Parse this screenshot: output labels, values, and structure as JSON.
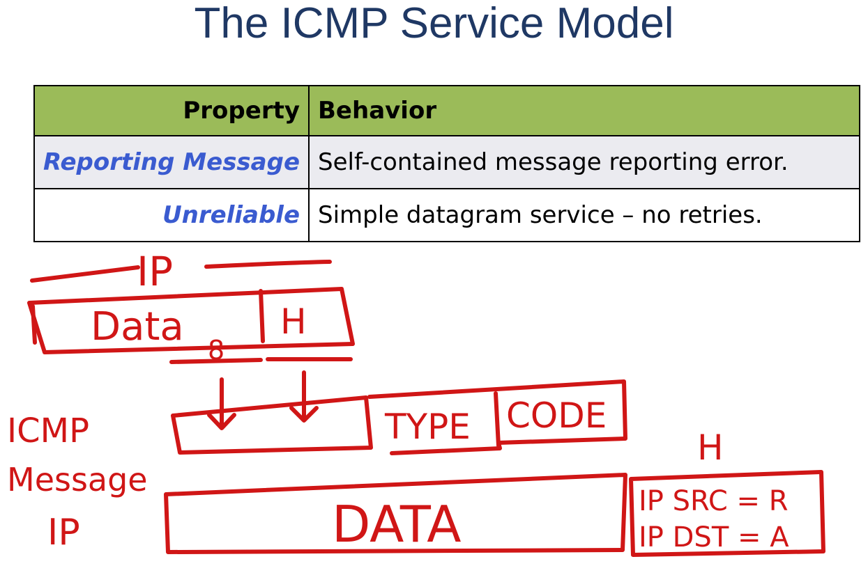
{
  "slide": {
    "title": "The ICMP Service Model"
  },
  "table": {
    "headers": [
      "Property",
      "Behavior"
    ],
    "rows": [
      {
        "property": "Reporting Message",
        "behavior": "Self-contained message reporting error."
      },
      {
        "property": "Unreliable",
        "behavior": "Simple datagram service – no retries."
      }
    ]
  },
  "annotations": {
    "ink_color": "#d01616",
    "ip_label": "IP",
    "data_label": "Data",
    "header_label": "H",
    "eight_label": "8",
    "type_label": "TYPE",
    "code_label": "CODE",
    "icmp_label": "ICMP",
    "message_label": "Message",
    "ip_side_label": "IP",
    "big_data_label": "DATA",
    "h_top_label": "H",
    "ip_src_label": "IP SRC = R",
    "ip_dst_label": "IP DST = A"
  }
}
